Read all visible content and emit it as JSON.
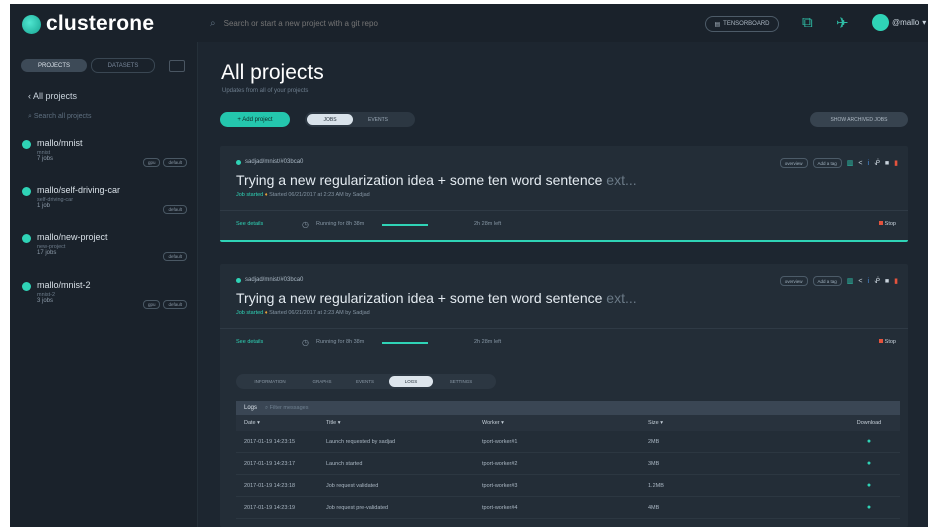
{
  "header": {
    "logo_text": "clusterone",
    "search_placeholder": "Search or start a new project with a git repo",
    "tensorboard_label": "TENSORBOARD",
    "user_name": "@mallo"
  },
  "sidebar": {
    "tabs": [
      {
        "label": "PROJECTS"
      },
      {
        "label": "DATASETS"
      }
    ],
    "back_label": "‹ All projects",
    "search_placeholder": "Search all projects",
    "projects": [
      {
        "name": "mallo/mnist",
        "sub": "mnist",
        "jobs": "7 jobs",
        "tags": [
          "gpu",
          "default"
        ]
      },
      {
        "name": "mallo/self-driving-car",
        "sub": "self-driving-car",
        "jobs": "1 job",
        "tags": [
          "default"
        ]
      },
      {
        "name": "mallo/new-project",
        "sub": "new-project",
        "jobs": "17 jobs",
        "tags": [
          "default"
        ]
      },
      {
        "name": "mallo/mnist-2",
        "sub": "mnist-2",
        "jobs": "3 jobs",
        "tags": [
          "gpu",
          "default"
        ]
      }
    ]
  },
  "main": {
    "title": "All projects",
    "subtitle": "Updates from all of your projects",
    "add_button": "+ Add project",
    "filters": [
      {
        "label": "JOBS"
      },
      {
        "label": "EVENTS"
      }
    ],
    "show_button": "SHOW ARCHIVED JOBS",
    "jobs": [
      {
        "head": "sadjad/mnist/#03bca0",
        "title": "Trying a new regularization idea + some ten word sentence",
        "title_fade": " ext...",
        "status": "Job started",
        "meta": "Started 06/21/2017 at 2:23 AM by Sadjad",
        "pills": [
          "overview",
          "Add a tag"
        ],
        "details": "See details",
        "running": "Running for 8h 38m",
        "eta": "2h 28m left",
        "stop": "Stop"
      },
      {
        "head": "sadjad/mnist/#03bca0",
        "title": "Trying a new regularization idea + some ten word sentence",
        "title_fade": " ext...",
        "status": "Job started",
        "meta": "Started 06/21/2017 at 2:23 AM by Sadjad",
        "pills": [
          "overview",
          "Add a tag"
        ],
        "details": "See details",
        "running": "Running for 8h 38m",
        "eta": "2h 28m left",
        "stop": "Stop"
      }
    ],
    "subtabs": [
      {
        "label": "INFORMATION"
      },
      {
        "label": "GRAPHS"
      },
      {
        "label": "EVENTS"
      },
      {
        "label": "LOGS"
      },
      {
        "label": "SETTINGS"
      }
    ],
    "logs": {
      "title": "Logs",
      "filter_placeholder": "Filter messages",
      "columns": [
        "Date",
        "Title",
        "Worker",
        "Size",
        "Download"
      ],
      "rows": [
        {
          "date": "2017-01-19 14:23:15",
          "title": "Launch requested by sadjad",
          "worker": "tport-worker#1",
          "size": "2MB"
        },
        {
          "date": "2017-01-19 14:23:17",
          "title": "Launch started",
          "worker": "tport-worker#2",
          "size": "3MB"
        },
        {
          "date": "2017-01-19 14:23:18",
          "title": "Job request validated",
          "worker": "tport-worker#3",
          "size": "1.2MB"
        },
        {
          "date": "2017-01-19 14:23:19",
          "title": "Job request pre-validated",
          "worker": "tport-worker#4",
          "size": "4MB"
        }
      ]
    }
  }
}
